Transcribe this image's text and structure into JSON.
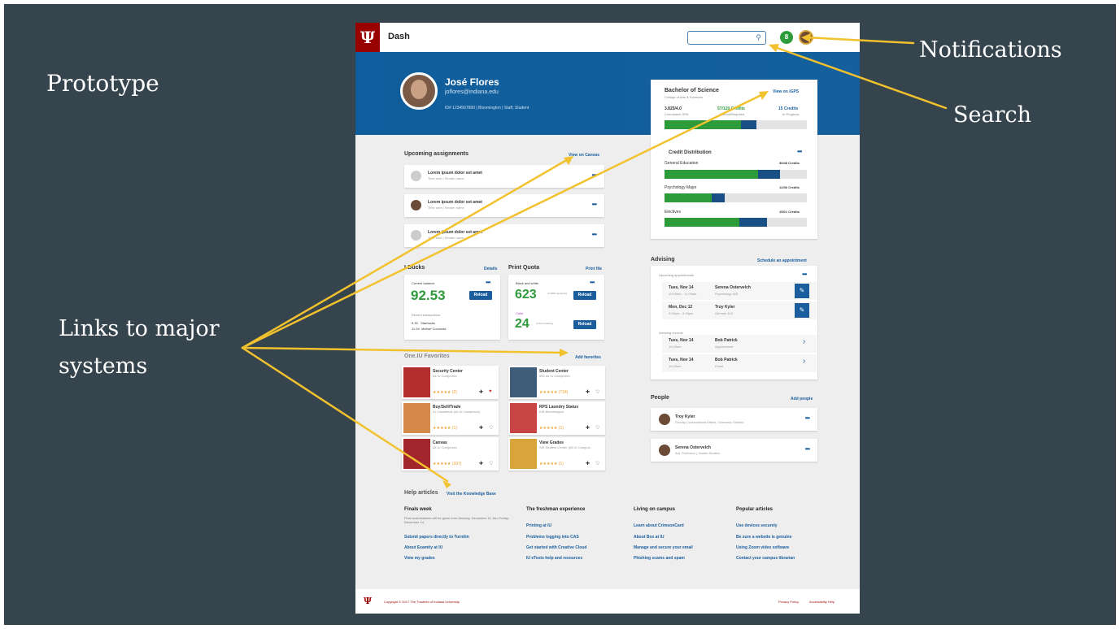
{
  "annotations": {
    "prototype": "Prototype",
    "notifications": "Notifications",
    "search": "Search",
    "links": "Links to major systems"
  },
  "app": {
    "logo": "Ψ",
    "brand": "Dash",
    "search_placeholder": "",
    "notif_count": "8"
  },
  "profile": {
    "name": "José Flores",
    "email": "joflores@indiana.edu",
    "meta": "ID# 1234567890  |  Bloomington  |  Staff, Student"
  },
  "degree": {
    "title": "Bachelor of Science",
    "subtitle": "College of Arts & Sciences",
    "link": "View on iGPS",
    "gpa": "3.825/4.0",
    "gpa_label": "Cumulative GPA",
    "credits": "57/120 Credits",
    "credits_label": "Earned/Required",
    "progress": "15 Credits",
    "progress_label": "In Progress",
    "dist_title": "Credit Distribution",
    "rows": [
      {
        "label": "General Education",
        "value": "30/48 Credits"
      },
      {
        "label": "Psychology Major",
        "value": "12/36 Credits"
      },
      {
        "label": "Electives",
        "value": "15/21 Credits"
      }
    ]
  },
  "assignments": {
    "title": "Upcoming assignments",
    "link": "View on Canvas",
    "items": [
      {
        "title": "Lorem ipsum dolor set amet",
        "sub": "Time sent  |  Sender name"
      },
      {
        "title": "Lorem ipsum dolor set amet",
        "sub": "Time sent  |  Sender name"
      },
      {
        "title": "Lorem ipsum dolor set amet",
        "sub": "Time sent  |  Sender name"
      }
    ]
  },
  "ibucks": {
    "title": "I-Bucks",
    "link": "Details",
    "balance_label": "Current balance",
    "balance": "92.53",
    "reload": "Reload",
    "recent": "Recent transactions",
    "tx": [
      {
        "amt": "3.33",
        "name": "Starbucks"
      },
      {
        "amt": "11.94",
        "name": "Mother Coconuts"
      }
    ]
  },
  "print": {
    "title": "Print Quota",
    "link": "Print file",
    "bw_label": "Black and white",
    "bw": "623",
    "bw_unit": "of 1000 remaining",
    "color_label": "Color",
    "color": "24",
    "color_unit": "of 50 remaining",
    "reload": "Reload"
  },
  "favorites": {
    "title": "One.IU Favorites",
    "link": "Add favorites",
    "items": [
      {
        "name": "Security Center",
        "sub": "All IU Campuses",
        "color": "#b22d2d",
        "stars": "★★★★★ (2)"
      },
      {
        "name": "Student Center",
        "sub": "IBG All IU Campuses",
        "color": "#3e5d7a",
        "stars": "★★★★★ (734)"
      },
      {
        "name": "Buy/Sell/Trade",
        "sub": "IU Classifieds (All IU Campuses)",
        "color": "#d58a4c",
        "stars": "★★★★★ (1)"
      },
      {
        "name": "RPS Laundry Status",
        "sub": "IUB Bloomington",
        "color": "#c84545",
        "stars": "★★★★★ (1)"
      },
      {
        "name": "Canvas",
        "sub": "All IU Campuses",
        "color": "#a3262c",
        "stars": "★★★★★ (337)"
      },
      {
        "name": "View Grades",
        "sub": "SIS Student Center (All IU Campus...",
        "color": "#d9a43a",
        "stars": "★★★★★ (1)"
      }
    ]
  },
  "advising": {
    "title": "Advising",
    "link": "Schedule an appointment",
    "upcoming_label": "Upcoming appointments",
    "upcoming": [
      {
        "date": "Tues, Nov 14",
        "time": "10:15am - 11:00am",
        "name": "Serena Ostervelch",
        "role": "Psychology 628"
      },
      {
        "date": "Mon, Dec 12",
        "time": "3:00pm - 3:15pm",
        "name": "Troy Kyler",
        "role": "German 110"
      }
    ],
    "records_label": "Advising records",
    "records": [
      {
        "date": "Tues, Nov 14",
        "time": "10:15am",
        "name": "Bob Patrick",
        "role": "Appointment"
      },
      {
        "date": "Tues, Nov 14",
        "time": "10:15am",
        "name": "Bob Patrick",
        "role": "Email"
      }
    ]
  },
  "people": {
    "title": "People",
    "link": "Add people",
    "items": [
      {
        "name": "Troy Kyler",
        "role": "Faculty | International Affairs, Germanic Studies"
      },
      {
        "name": "Serena Ostervelch",
        "role": "Adj. Professor | Jewish Studies"
      }
    ]
  },
  "help": {
    "title": "Help articles",
    "link": "Visit the Knowledge Base",
    "columns": [
      {
        "heading": "Finals week",
        "para": "Final examinations will be given from Monday, December 10, thru Friday, December 14.",
        "links": [
          "Submit papers directly to Turnitin",
          "About Examity at IU",
          "View my grades"
        ]
      },
      {
        "heading": "The freshman experience",
        "para": "",
        "links": [
          "Printing at IU",
          "Problems logging into CAS",
          "Get started with Creative Cloud",
          "IU eTexts help and resources"
        ]
      },
      {
        "heading": "Living on campus",
        "para": "",
        "links": [
          "Learn about CrimsonCard",
          "About Box at IU",
          "Manage and secure your email",
          "Phishing scams and spam"
        ]
      },
      {
        "heading": "Popular articles",
        "para": "",
        "links": [
          "Use devices securely",
          "Be sure a website is genuine",
          "Using Zoom video software",
          "Contact your campus librarian"
        ]
      }
    ]
  },
  "footer": {
    "copyright": "Copyright © 2017 The Trustees of Indiana University",
    "privacy": "Privacy Policy",
    "accessibility": "Accessibility Help"
  },
  "colors": {
    "slide_bg": "#36444d",
    "iu_crimson": "#990000",
    "hero_blue": "#0f5d9c",
    "arrow": "#f2c12e",
    "progress_green": "#2e9b3b",
    "progress_blue": "#1a4f86"
  }
}
